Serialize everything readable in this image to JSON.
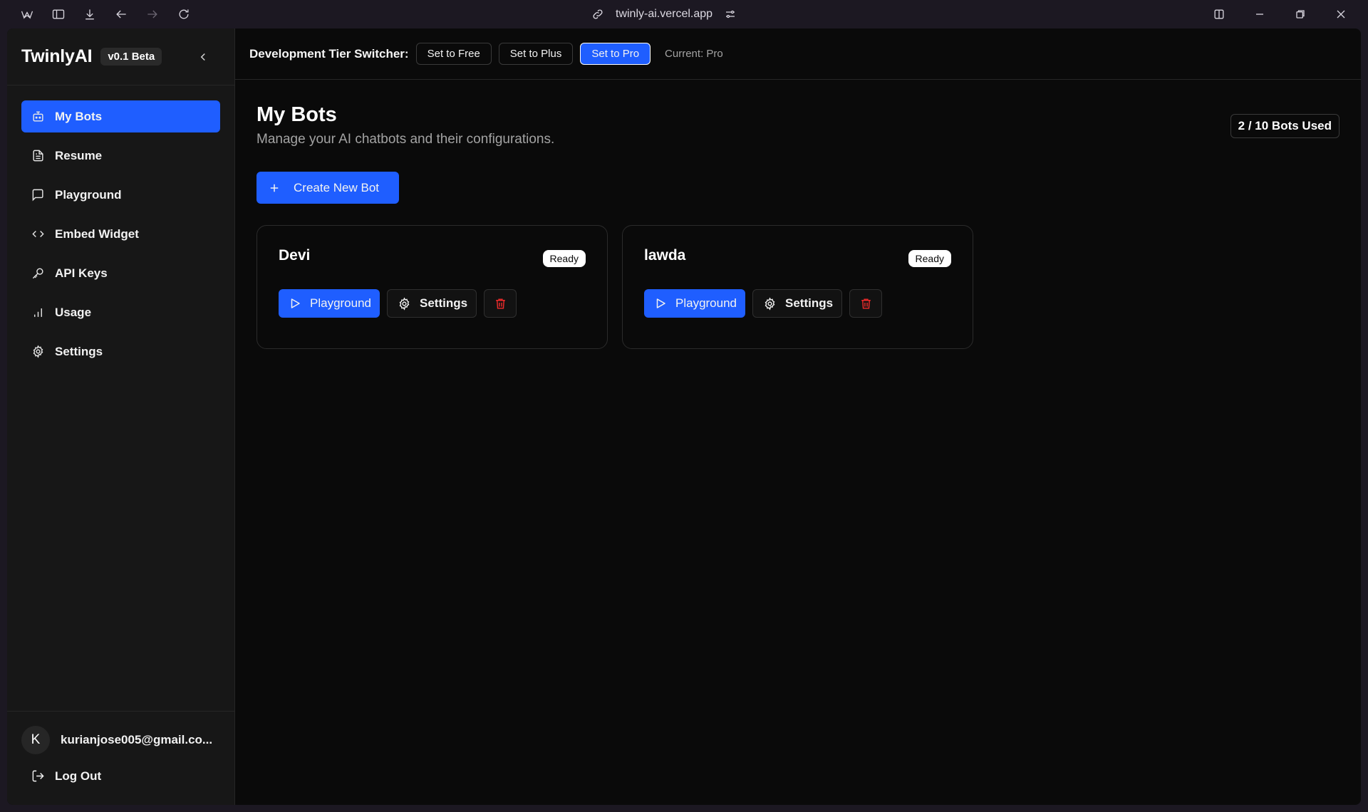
{
  "browser": {
    "url": "twinly-ai.vercel.app"
  },
  "sidebar": {
    "brand": "TwinlyAI",
    "version": "v0.1 Beta",
    "items": [
      {
        "label": "My Bots",
        "icon": "bot-icon",
        "active": true
      },
      {
        "label": "Resume",
        "icon": "file-text-icon"
      },
      {
        "label": "Playground",
        "icon": "message-square-icon"
      },
      {
        "label": "Embed Widget",
        "icon": "code-icon"
      },
      {
        "label": "API Keys",
        "icon": "key-icon"
      },
      {
        "label": "Usage",
        "icon": "bar-chart-icon"
      },
      {
        "label": "Settings",
        "icon": "gear-icon"
      }
    ],
    "user": {
      "initial": "K",
      "email": "kurianjose005@gmail.co..."
    },
    "logout_label": "Log Out"
  },
  "topbar": {
    "label": "Development Tier Switcher:",
    "buttons": [
      "Set to Free",
      "Set to Plus",
      "Set to Pro"
    ],
    "active_button": "Set to Pro",
    "current": "Current: Pro"
  },
  "main": {
    "title": "My Bots",
    "subtitle": "Manage your AI chatbots and their configurations.",
    "usage": "2 / 10 Bots Used",
    "create_label": "Create New Bot",
    "bots": [
      {
        "name": "Devi",
        "status": "Ready",
        "playground_label": "Playground",
        "settings_label": "Settings"
      },
      {
        "name": "lawda",
        "status": "Ready",
        "playground_label": "Playground",
        "settings_label": "Settings"
      }
    ]
  },
  "colors": {
    "accent": "#1f5eff",
    "danger": "#ef2b2b",
    "background": "#0a0a0a",
    "sidebar": "#171717"
  }
}
